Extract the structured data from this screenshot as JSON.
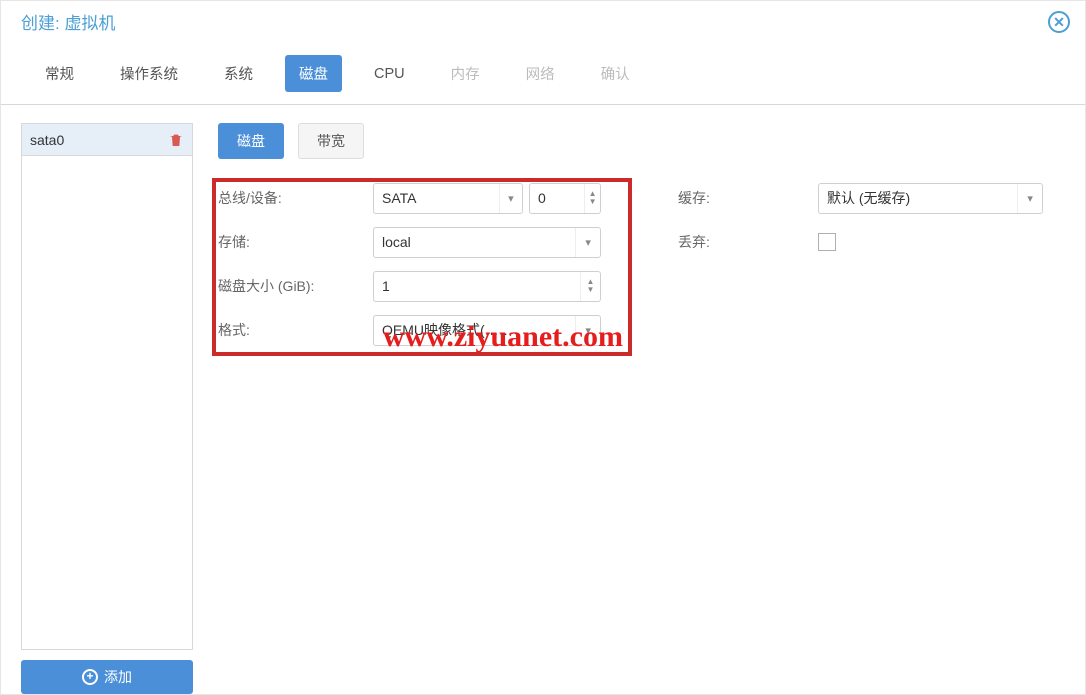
{
  "header": {
    "title": "创建: 虚拟机"
  },
  "tabs": {
    "t0": "常规",
    "t1": "操作系统",
    "t2": "系统",
    "t3": "磁盘",
    "t4": "CPU",
    "t5": "内存",
    "t6": "网络",
    "t7": "确认"
  },
  "sidebar": {
    "item0": "sata0",
    "add_label": "添加"
  },
  "subtabs": {
    "disk": "磁盘",
    "bandwidth": "带宽"
  },
  "form": {
    "bus_device_label": "总线/设备:",
    "bus_value": "SATA",
    "device_value": "0",
    "storage_label": "存储:",
    "storage_value": "local",
    "disk_size_label": "磁盘大小 (GiB):",
    "disk_size_value": "1",
    "format_label": "格式:",
    "format_value": "QEMU映像格式(……",
    "cache_label": "缓存:",
    "cache_value": "默认 (无缓存)",
    "discard_label": "丢弃:"
  },
  "watermark": "www.ziyuanet.com"
}
